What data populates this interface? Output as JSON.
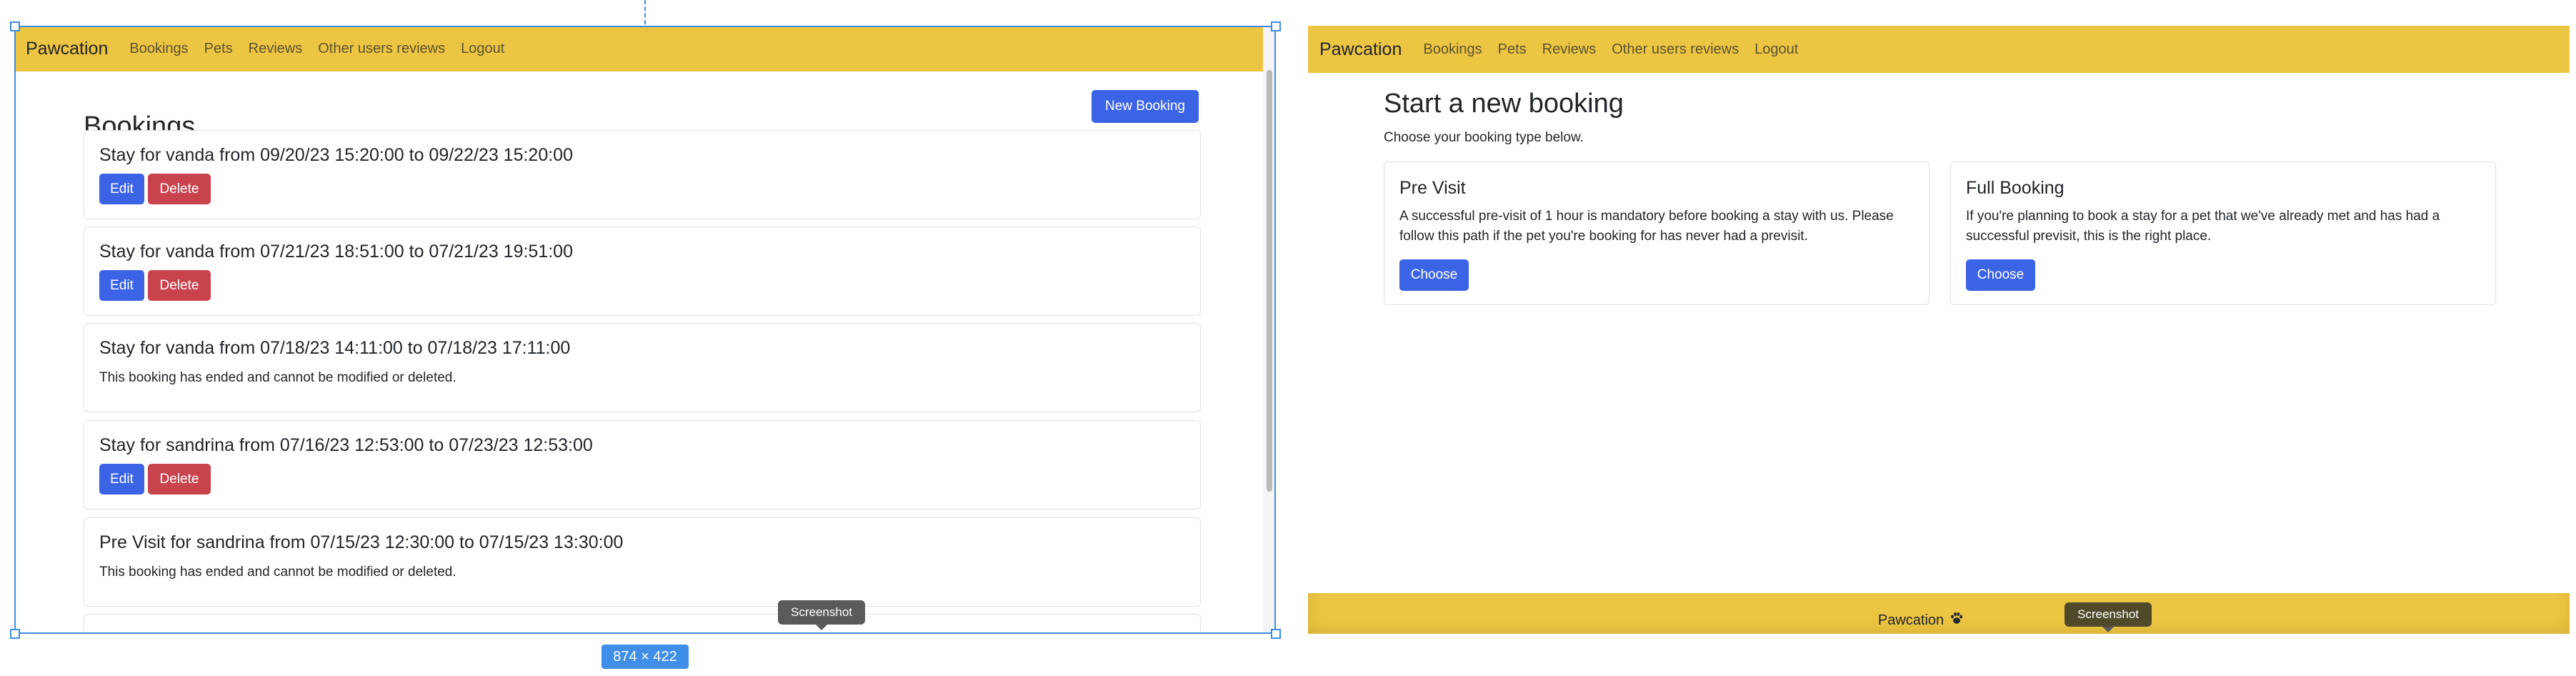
{
  "left": {
    "navbar": {
      "brand": "Pawcation",
      "links": [
        "Bookings",
        "Pets",
        "Reviews",
        "Other users reviews",
        "Logout"
      ]
    },
    "page_title": "Bookings",
    "new_booking_label": "New Booking",
    "bookings": [
      {
        "title": "Stay for vanda from 09/20/23 15:20:00 to 09/22/23 15:20:00",
        "edit_label": "Edit",
        "delete_label": "Delete"
      },
      {
        "title": "Stay for vanda from 07/21/23 18:51:00 to 07/21/23 19:51:00",
        "edit_label": "Edit",
        "delete_label": "Delete"
      },
      {
        "title": "Stay for vanda from 07/18/23 14:11:00 to 07/18/23 17:11:00",
        "note": "This booking has ended and cannot be modified or deleted."
      },
      {
        "title": "Stay for sandrina from 07/16/23 12:53:00 to 07/23/23 12:53:00",
        "edit_label": "Edit",
        "delete_label": "Delete"
      },
      {
        "title": "Pre Visit for sandrina from 07/15/23 12:30:00 to 07/15/23 13:30:00",
        "note": "This booking has ended and cannot be modified or deleted."
      }
    ],
    "screenshot_tooltip": "Screenshot",
    "dimension_label": "874 × 422"
  },
  "right": {
    "navbar": {
      "brand": "Pawcation",
      "links": [
        "Bookings",
        "Pets",
        "Reviews",
        "Other users reviews",
        "Logout"
      ]
    },
    "page_title": "Start a new booking",
    "subtitle": "Choose your booking type below.",
    "booking_types": [
      {
        "title": "Pre Visit",
        "description": "A successful pre-visit of 1 hour is mandatory before booking a stay with us. Please follow this path if the pet you're booking for has never had a previsit.",
        "button_label": "Choose"
      },
      {
        "title": "Full Booking",
        "description": "If you're planning to book a stay for a pet that we've already met and has had a successful previsit, this is the right place.",
        "button_label": "Choose"
      }
    ],
    "footer": {
      "brand": "Pawcation",
      "icon": "paw-icon"
    },
    "screenshot_tooltip": "Screenshot"
  },
  "colors": {
    "navbar_bg": "#ecc542",
    "primary_button": "#3b63e6",
    "danger_button": "#c9434d",
    "selection": "#3d8ce6"
  }
}
